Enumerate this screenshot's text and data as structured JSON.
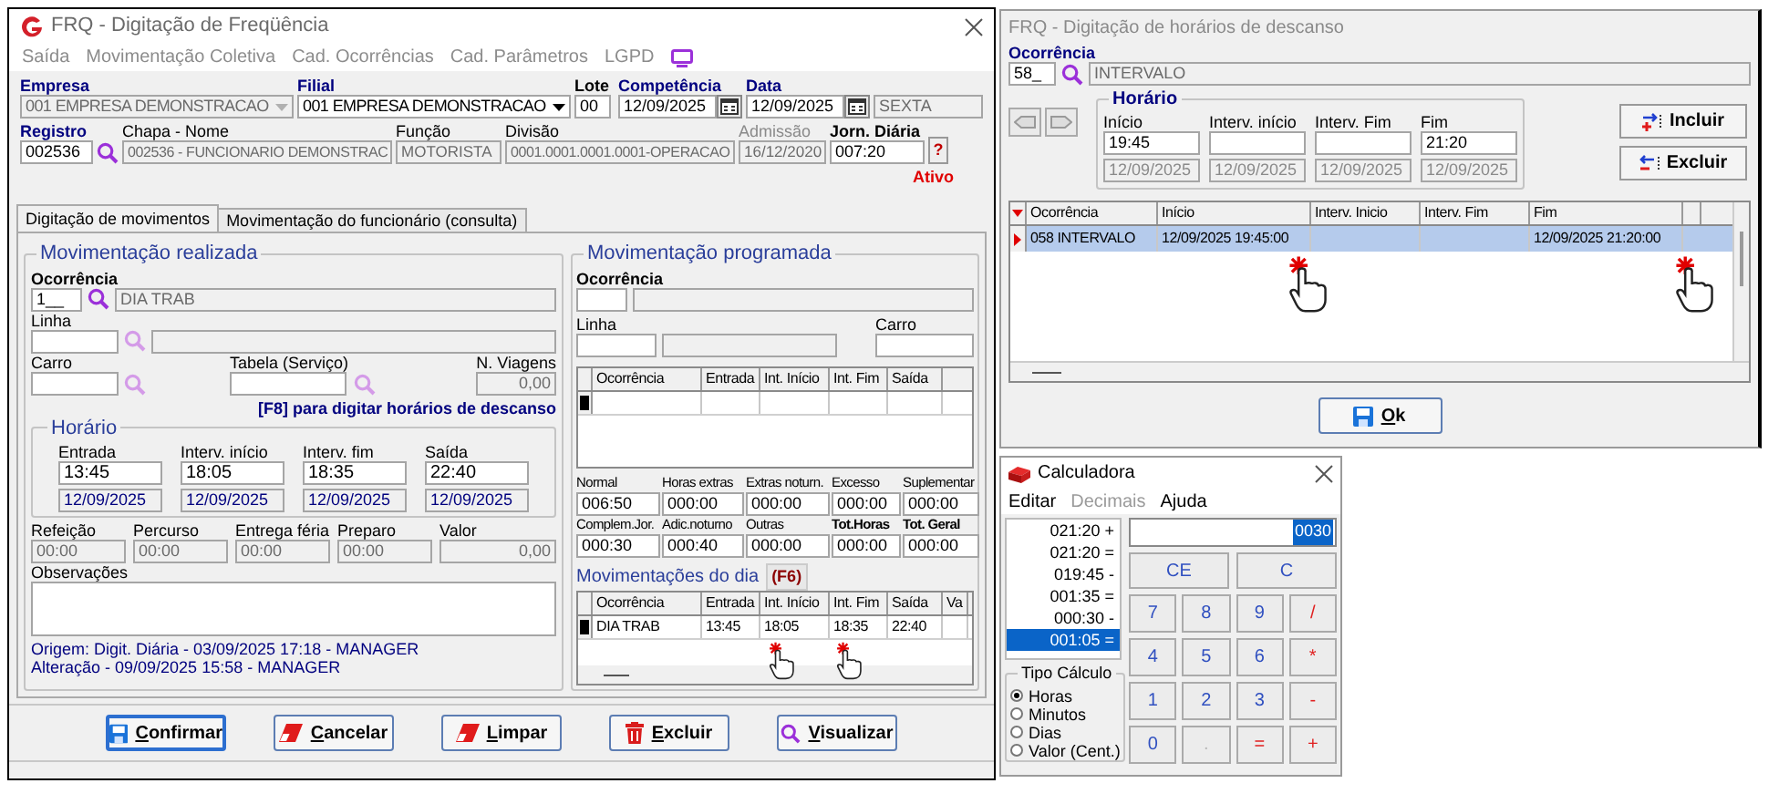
{
  "main_window": {
    "title": "FRQ - Digitação de Freqüência",
    "menu": [
      "Saída",
      "Movimentação Coletiva",
      "Cad. Ocorrências",
      "Cad. Parâmetros",
      "LGPD"
    ],
    "company": {
      "label": "Empresa",
      "value": "001 EMPRESA DEMONSTRACAO",
      "disabled": true
    },
    "branch": {
      "label": "Filial",
      "value": "001 EMPRESA DEMONSTRACAO",
      "disabled": false
    },
    "batch": {
      "label": "Lote",
      "value": "00",
      "disabled": false
    },
    "competence": {
      "label": "Competência",
      "value": "12/09/2025",
      "disabled": false
    },
    "date": {
      "label": "Data",
      "value": "12/09/2025",
      "disabled": false
    },
    "weekday": {
      "value": "SEXTA",
      "disabled": true
    },
    "registration": {
      "label": "Registro",
      "value": "002536",
      "disabled": false
    },
    "employee": {
      "label": "Chapa - Nome",
      "value": "002536 - FUNCIONARIO DEMONSTRAC",
      "disabled": true
    },
    "role": {
      "label": "Função",
      "value": "MOTORISTA",
      "disabled": true
    },
    "division": {
      "label": "Divisão",
      "value": "0001.0001.0001.0001-OPERACAO",
      "disabled": true
    },
    "admission": {
      "label": "Admissão",
      "value": "16/12/2020",
      "disabled": true
    },
    "daily_hours": {
      "label": "Jorn. Diária",
      "value": "007:20",
      "disabled": false
    },
    "help_button": "?",
    "status": "Ativo",
    "tabs": [
      {
        "label": "Digitação de movimentos",
        "selected": true
      },
      {
        "label": "Movimentação do funcionário (consulta)",
        "selected": false
      }
    ],
    "performed": {
      "title": "Movimentação realizada",
      "occurrence": {
        "label": "Ocorrência",
        "value": "1__",
        "disabled": false
      },
      "occurrence_name": {
        "value": "DIA TRAB",
        "disabled": true
      },
      "line": {
        "label": "Linha",
        "disabled": false
      },
      "line_name": {
        "disabled": true
      },
      "car": {
        "label": "Carro",
        "disabled": false
      },
      "service_table": {
        "label": "Tabela (Serviço)",
        "disabled": false
      },
      "trips": {
        "label": "N. Viagens",
        "value": "0,00",
        "disabled": true
      },
      "hint": "[F8] para digitar horários de descanso",
      "schedule": {
        "title": "Horário",
        "times": [
          {
            "label": "Entrada",
            "time": {
              "value": "13:45",
              "disabled": false
            },
            "date": {
              "value": "12/09/2025",
              "disabled": true
            }
          },
          {
            "label": "Interv. início",
            "time": {
              "value": "18:05",
              "disabled": false
            },
            "date": {
              "value": "12/09/2025",
              "disabled": true
            }
          },
          {
            "label": "Interv. fim",
            "time": {
              "value": "18:35",
              "disabled": false
            },
            "date": {
              "value": "12/09/2025",
              "disabled": true
            }
          },
          {
            "label": "Saída",
            "time": {
              "value": "22:40",
              "disabled": false
            },
            "date": {
              "value": "12/09/2025",
              "disabled": true
            }
          }
        ]
      },
      "extras": [
        {
          "label": "Refeição",
          "value": "00:00",
          "disabled": true
        },
        {
          "label": "Percurso",
          "value": "00:00",
          "disabled": true
        },
        {
          "label": "Entrega féria",
          "value": "00:00",
          "disabled": true
        },
        {
          "label": "Preparo",
          "value": "00:00",
          "disabled": true
        },
        {
          "label": "Valor",
          "value": "0,00",
          "disabled": true
        }
      ],
      "notes": {
        "label": "Observações",
        "disabled": false
      },
      "origin": "Origem: Digit. Diária - 03/09/2025 17:18 - MANAGER",
      "changed": "Alteração - 09/09/2025 15:58 - MANAGER"
    },
    "scheduled": {
      "title": "Movimentação programada",
      "occurrence": {
        "label": "Ocorrência",
        "disabled": false
      },
      "occurrence_name": {
        "disabled": true
      },
      "line": {
        "label": "Linha",
        "disabled": false
      },
      "line_name": {
        "disabled": true
      },
      "car": {
        "label": "Carro",
        "disabled": false
      },
      "columns": [
        "Ocorrência",
        "Entrada",
        "Int. Início",
        "Int. Fim",
        "Saída"
      ],
      "totals": [
        {
          "label": "Normal",
          "value": "006:50",
          "kind": "normal"
        },
        {
          "label": "Horas extras",
          "value": "000:00",
          "kind": "normal"
        },
        {
          "label": "Extras noturn.",
          "value": "000:00",
          "kind": "normal"
        },
        {
          "label": "Excesso",
          "value": "000:00",
          "kind": "normal"
        },
        {
          "label": "Suplementar",
          "value": "000:00",
          "kind": "normal"
        },
        {
          "label": "Complem.Jor.",
          "value": "000:30",
          "kind": "normal"
        },
        {
          "label": "Adic.noturno",
          "value": "000:40",
          "kind": "normal"
        },
        {
          "label": "Outras",
          "value": "000:00",
          "kind": "normal"
        },
        {
          "label": "Tot.Horas",
          "value": "000:00",
          "kind": "total"
        },
        {
          "label": "Tot. Geral",
          "value": "000:00",
          "kind": "total"
        }
      ]
    },
    "day_movements": {
      "title": "Movimentações do dia",
      "shortcut": "(F6)",
      "columns": [
        "Ocorrência",
        "Entrada",
        "Int. Início",
        "Int. Fim",
        "Saída",
        "Va"
      ],
      "rows": [
        {
          "cells": [
            "DIA TRAB",
            "13:45",
            "18:05",
            "18:35",
            "22:40"
          ]
        }
      ]
    },
    "buttons": [
      {
        "label": "Confirmar",
        "kind": "confirm",
        "focused": true
      },
      {
        "label": "Cancelar",
        "kind": "cancel",
        "focused": false
      },
      {
        "label": "Limpar",
        "kind": "clear",
        "focused": false
      },
      {
        "label": "Excluir",
        "kind": "delete",
        "focused": false
      },
      {
        "label": "Visualizar",
        "kind": "view",
        "focused": false
      }
    ]
  },
  "rest_window": {
    "title": "FRQ - Digitação de horários de descanso",
    "occurrence": {
      "label": "Ocorrência",
      "value": "58_",
      "disabled": false
    },
    "occurrence_name": {
      "value": "INTERVALO",
      "disabled": true
    },
    "schedule": {
      "title": "Horário",
      "times": [
        {
          "label": "Início",
          "time": {
            "value": "19:45",
            "disabled": false
          },
          "date": {
            "value": "12/09/2025",
            "disabled": true
          }
        },
        {
          "label": "Interv. início",
          "time": {
            "disabled": false
          },
          "date": {
            "value": "12/09/2025",
            "disabled": true
          }
        },
        {
          "label": "Interv. Fim",
          "time": {
            "disabled": false
          },
          "date": {
            "value": "12/09/2025",
            "disabled": true
          }
        },
        {
          "label": "Fim",
          "time": {
            "value": "21:20",
            "disabled": false
          },
          "date": {
            "value": "12/09/2025",
            "disabled": true
          }
        }
      ]
    },
    "actions": [
      {
        "label": "Incluir",
        "kind": "add"
      },
      {
        "label": "Excluir",
        "kind": "remove"
      }
    ],
    "columns": [
      "Ocorrência",
      "Início",
      "Interv. Inicio",
      "Interv. Fim",
      "Fim"
    ],
    "rows": [
      {
        "selected": true,
        "occurrence": "058 INTERVALO",
        "start": "12/09/2025 19:45:00",
        "end": "12/09/2025 21:20:00"
      }
    ],
    "ok_button": "Ok"
  },
  "calculator": {
    "title": "Calculadora",
    "menu": [
      {
        "label": "Editar",
        "disabled": false
      },
      {
        "label": "Decimais",
        "disabled": true
      },
      {
        "label": "Ajuda",
        "disabled": false
      }
    ],
    "tape": [
      {
        "text": "021:20 +",
        "selected": false
      },
      {
        "text": "021:20 =",
        "selected": false
      },
      {
        "text": "019:45 -",
        "selected": false
      },
      {
        "text": "001:35 =",
        "selected": false
      },
      {
        "text": "000:30 -",
        "selected": false
      },
      {
        "text": "001:05 =",
        "selected": true
      }
    ],
    "display": "0030",
    "clear_keys": [
      "CE",
      "C"
    ],
    "keys": [
      {
        "label": "7",
        "kind": "digit",
        "disabled": false
      },
      {
        "label": "8",
        "kind": "digit",
        "disabled": false
      },
      {
        "label": "9",
        "kind": "digit",
        "disabled": false
      },
      {
        "label": "/",
        "kind": "operator",
        "disabled": false
      },
      {
        "label": "4",
        "kind": "digit",
        "disabled": false
      },
      {
        "label": "5",
        "kind": "digit",
        "disabled": false
      },
      {
        "label": "6",
        "kind": "digit",
        "disabled": false
      },
      {
        "label": "*",
        "kind": "operator",
        "disabled": false
      },
      {
        "label": "1",
        "kind": "digit",
        "disabled": false
      },
      {
        "label": "2",
        "kind": "digit",
        "disabled": false
      },
      {
        "label": "3",
        "kind": "digit",
        "disabled": false
      },
      {
        "label": "-",
        "kind": "operator",
        "disabled": false
      },
      {
        "label": "0",
        "kind": "digit",
        "disabled": false
      },
      {
        "label": ".",
        "kind": "digit",
        "disabled": true
      },
      {
        "label": "=",
        "kind": "operator",
        "disabled": false
      },
      {
        "label": "+",
        "kind": "operator",
        "disabled": false
      }
    ],
    "calc_type": {
      "title": "Tipo Cálculo",
      "options": [
        {
          "label": "Horas",
          "selected": true
        },
        {
          "label": "Minutos",
          "selected": false
        },
        {
          "label": "Dias",
          "selected": false
        },
        {
          "label": "Valor (Cent.)",
          "selected": false
        }
      ]
    }
  }
}
